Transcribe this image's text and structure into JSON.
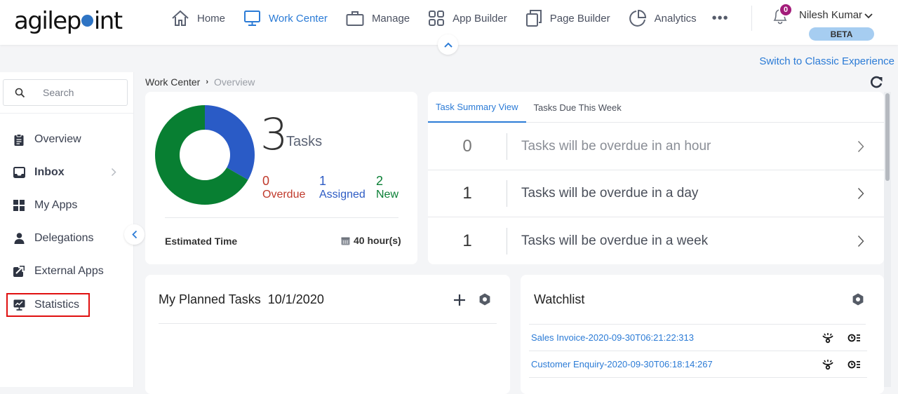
{
  "header": {
    "logo_text_pre": "agilep",
    "logo_text_post": "int",
    "nav": [
      {
        "label": "Home",
        "icon": "home-icon",
        "active": false
      },
      {
        "label": "Work Center",
        "icon": "monitor-icon",
        "active": true
      },
      {
        "label": "Manage",
        "icon": "briefcase-icon",
        "active": false
      },
      {
        "label": "App Builder",
        "icon": "grid-icon",
        "active": false
      },
      {
        "label": "Page Builder",
        "icon": "pages-icon",
        "active": false
      },
      {
        "label": "Analytics",
        "icon": "pie-chart-icon",
        "active": false
      }
    ],
    "more_label": "•••",
    "notification_count": "0",
    "user_name": "Nilesh Kumar",
    "beta_label": "BETA",
    "switch_link": "Switch to Classic Experience"
  },
  "sidebar": {
    "search_placeholder": "Search",
    "items": [
      {
        "label": "Overview",
        "icon": "clipboard-icon"
      },
      {
        "label": "Inbox",
        "icon": "inbox-icon",
        "has_children": true
      },
      {
        "label": "My Apps",
        "icon": "apps-grid-icon"
      },
      {
        "label": "Delegations",
        "icon": "person-icon"
      },
      {
        "label": "External Apps",
        "icon": "external-link-icon"
      },
      {
        "label": "Statistics",
        "icon": "statistics-monitor-icon",
        "highlighted": true
      }
    ]
  },
  "breadcrumb": {
    "parent": "Work Center",
    "current": "Overview"
  },
  "summary": {
    "total": "3",
    "total_label": "Tasks",
    "stats": [
      {
        "value": "0",
        "label": "Overdue",
        "color": "#c0392b"
      },
      {
        "value": "1",
        "label": "Assigned",
        "color": "#2d5bc4"
      },
      {
        "value": "2",
        "label": "New",
        "color": "#0a7f35"
      }
    ],
    "donut": [
      {
        "label": "Assigned",
        "value": 1,
        "color": "#2a5bc6"
      },
      {
        "label": "New",
        "value": 2,
        "color": "#087f32"
      }
    ],
    "estimated_label": "Estimated Time",
    "estimated_value": "40 hour(s)"
  },
  "task_panel": {
    "tabs": [
      {
        "label": "Task Summary View",
        "active": true
      },
      {
        "label": "Tasks Due This Week",
        "active": false
      }
    ],
    "rows": [
      {
        "count": "0",
        "text": "Tasks will be overdue in an hour",
        "muted": true
      },
      {
        "count": "1",
        "text": "Tasks will be overdue in a day",
        "muted": false
      },
      {
        "count": "1",
        "text": "Tasks will be overdue in a week",
        "muted": false
      }
    ]
  },
  "planned": {
    "title": "My Planned Tasks",
    "date": "10/1/2020"
  },
  "watchlist": {
    "title": "Watchlist",
    "items": [
      {
        "name": "Sales Invoice-2020-09-30T06:21:22:313"
      },
      {
        "name": "Customer Enquiry-2020-09-30T06:18:14:267"
      }
    ]
  }
}
